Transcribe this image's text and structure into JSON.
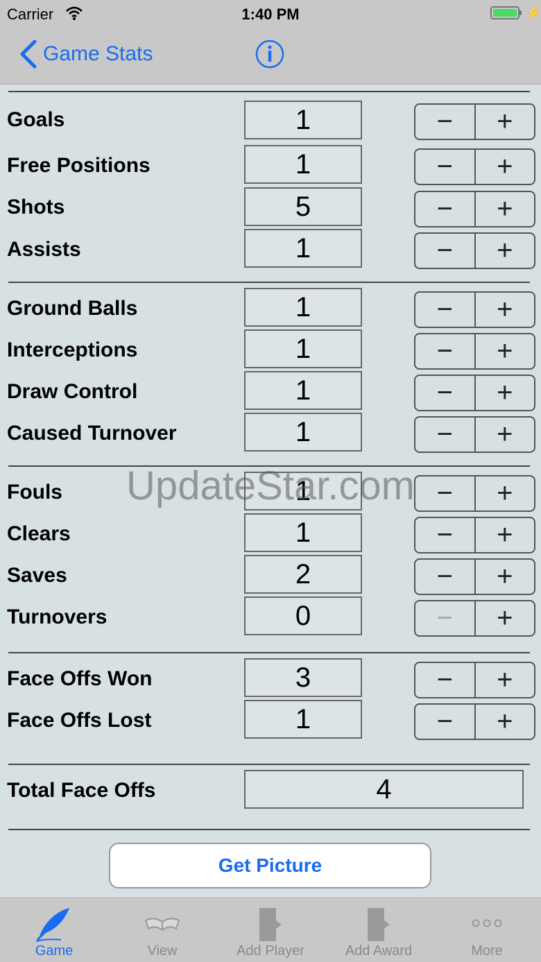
{
  "status_bar": {
    "carrier": "Carrier",
    "time": "1:40 PM"
  },
  "nav": {
    "back_label": "Game Stats"
  },
  "sections": [
    [
      {
        "label": "Goals",
        "value": "1"
      },
      {
        "label": "Free Positions",
        "value": "1"
      },
      {
        "label": "Shots",
        "value": "5"
      },
      {
        "label": "Assists",
        "value": "1"
      }
    ],
    [
      {
        "label": "Ground Balls",
        "value": "1"
      },
      {
        "label": "Interceptions",
        "value": "1"
      },
      {
        "label": "Draw Control",
        "value": "1"
      },
      {
        "label": "Caused Turnover",
        "value": "1"
      }
    ],
    [
      {
        "label": "Fouls",
        "value": "1"
      },
      {
        "label": "Clears",
        "value": "1"
      },
      {
        "label": "Saves",
        "value": "2"
      },
      {
        "label": "Turnovers",
        "value": "0"
      }
    ],
    [
      {
        "label": "Face Offs Won",
        "value": "3"
      },
      {
        "label": "Face Offs Lost",
        "value": "1"
      }
    ]
  ],
  "stepper": {
    "minus": "−",
    "plus": "+"
  },
  "total": {
    "label": "Total Face Offs",
    "value": "4"
  },
  "get_picture_label": "Get Picture",
  "watermark": "UpdateStar.com",
  "tabs": [
    {
      "label": "Game",
      "icon": "quill-icon",
      "active": true
    },
    {
      "label": "View",
      "icon": "book-icon",
      "active": false
    },
    {
      "label": "Add Player",
      "icon": "add-player-icon",
      "active": false
    },
    {
      "label": "Add Award",
      "icon": "add-award-icon",
      "active": false
    },
    {
      "label": "More",
      "icon": "more-icon",
      "active": false
    }
  ],
  "colors": {
    "accent": "#1a6cf0",
    "background": "#d7e1e3",
    "bar": "#c8c8c8",
    "battery": "#4cd964"
  }
}
